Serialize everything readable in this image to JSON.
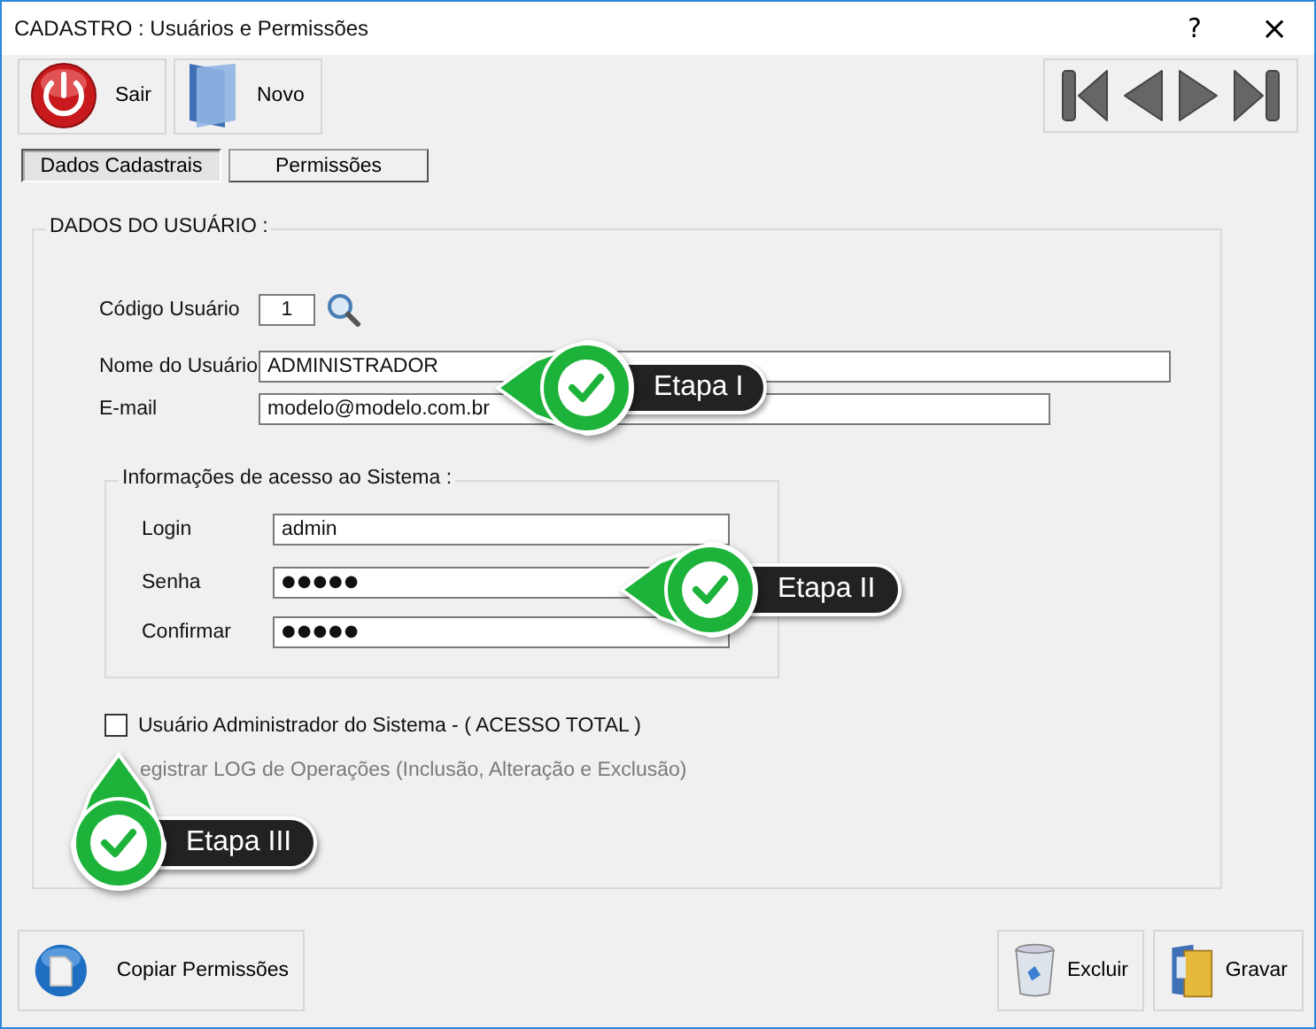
{
  "window": {
    "title": "CADASTRO : Usuários e Permissões",
    "controls": [
      "?",
      "×"
    ]
  },
  "toolbar": [
    {
      "label": "Sair",
      "kind": "power"
    },
    {
      "label": "Novo",
      "kind": "new"
    }
  ],
  "tabs": [
    {
      "label": "Dados Cadastrais",
      "selected": true
    },
    {
      "label": "Permissões",
      "selected": false
    }
  ],
  "user_data": {
    "title": "DADOS DO USUÁRIO :",
    "fields": [
      {
        "label": "Código Usuário",
        "value": "1",
        "kind": "code"
      },
      {
        "label": "Nome do Usuário",
        "value": "ADMINISTRADOR",
        "kind": "wide"
      },
      {
        "label": "E-mail",
        "value": "modelo@modelo.com.br",
        "kind": "medium"
      }
    ]
  },
  "access": {
    "title": "Informações de acesso ao Sistema :",
    "fields": [
      {
        "label": "Login",
        "value": "admin"
      },
      {
        "label": "Senha",
        "value": "●●●●●"
      },
      {
        "label": "Confirmar",
        "value": "●●●●●"
      }
    ]
  },
  "options": [
    {
      "label": "Usuário Administrador do Sistema - ( ACESSO TOTAL )",
      "checked": false,
      "disabled": false
    },
    {
      "label": "egistrar LOG de Operações (Inclusão, Alteração e Exclusão)",
      "disabled": true
    }
  ],
  "callouts": [
    {
      "label": "Etapa I",
      "kind": "left"
    },
    {
      "label": "Etapa II",
      "kind": "left"
    },
    {
      "label": "Etapa III",
      "kind": "up"
    }
  ],
  "actions": [
    {
      "label": "Copiar Permissões",
      "kind": "copy"
    },
    {
      "label": "Excluir",
      "kind": "delete"
    },
    {
      "label": "Gravar",
      "kind": "save"
    }
  ]
}
